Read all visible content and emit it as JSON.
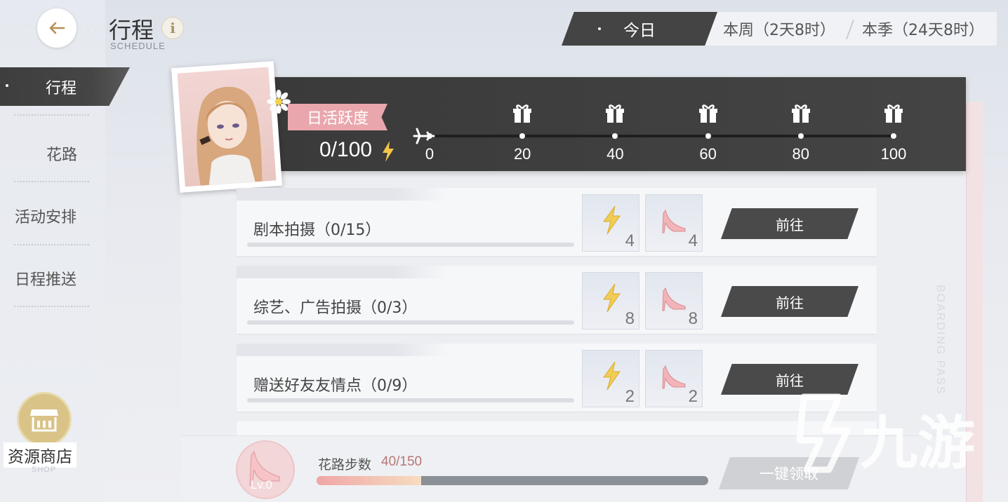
{
  "header": {
    "title": "行程",
    "subtitle": "SCHEDULE",
    "info_glyph": "i",
    "tabs": [
      {
        "label": "今日",
        "active": true
      },
      {
        "label": "本周（2天8时）",
        "active": false
      },
      {
        "label": "本季（24天8时）",
        "active": false
      }
    ]
  },
  "sidebar": {
    "items": [
      {
        "label": "行程",
        "active": true
      },
      {
        "label": "花路",
        "active": false
      },
      {
        "label": "活动安排",
        "active": false
      },
      {
        "label": "日程推送",
        "active": false
      }
    ],
    "shop_label": "资源商店",
    "shop_sub": "SHOP"
  },
  "activity": {
    "label": "日活跃度",
    "value": "0/100",
    "milestones": [
      "0",
      "20",
      "40",
      "60",
      "80",
      "100"
    ]
  },
  "tasks": [
    {
      "name": "剧本拍摄（0/15）",
      "rewards": [
        {
          "icon": "lightning-icon",
          "count": "4"
        },
        {
          "icon": "high-heel-icon",
          "count": "4"
        }
      ],
      "button": "前往"
    },
    {
      "name": "综艺、广告拍摄（0/3）",
      "rewards": [
        {
          "icon": "lightning-icon",
          "count": "8"
        },
        {
          "icon": "high-heel-icon",
          "count": "8"
        }
      ],
      "button": "前往"
    },
    {
      "name": "赠送好友友情点（0/9）",
      "rewards": [
        {
          "icon": "lightning-icon",
          "count": "2"
        },
        {
          "icon": "high-heel-icon",
          "count": "2"
        }
      ],
      "button": "前往"
    }
  ],
  "footer": {
    "level": "Lv.0",
    "steps_label": "花路步数",
    "steps_value": "40/150",
    "steps_fraction": 0.267,
    "claim_button": "一键领取"
  },
  "decor": {
    "boarding_text": "BOARDING PASS",
    "watermark": "九游"
  },
  "colors": {
    "accent_dark": "#444444",
    "accent_pink": "#e9a7ad",
    "progress_pink": "#f0a6a6"
  }
}
